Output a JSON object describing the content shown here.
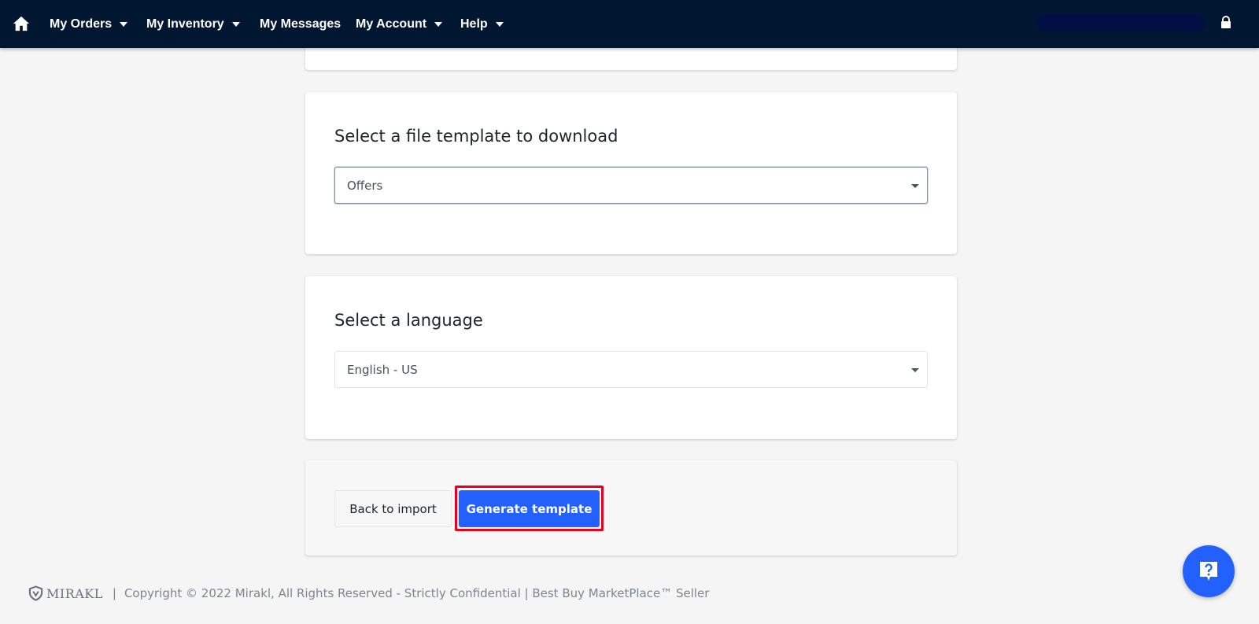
{
  "nav": {
    "home_icon": "home-icon",
    "items": [
      {
        "label": "My Orders",
        "dropdown": true
      },
      {
        "label": "My Inventory",
        "dropdown": true
      },
      {
        "label": "My Messages",
        "dropdown": false
      },
      {
        "label": "My Account",
        "dropdown": true
      },
      {
        "label": "Help",
        "dropdown": true
      }
    ],
    "lock_icon": "lock-icon"
  },
  "template_section": {
    "title": "Select a file template to download",
    "selected": "Offers"
  },
  "language_section": {
    "title": "Select a language",
    "selected": "English - US"
  },
  "actions": {
    "back_label": "Back to import",
    "generate_label": "Generate template"
  },
  "footer": {
    "logo_text": "MIRAKL",
    "separator": "|",
    "copyright": "Copyright © 2022 Mirakl, All Rights Reserved - Strictly Confidential | Best Buy MarketPlace™ Seller"
  },
  "help_button": {
    "icon": "question-icon"
  },
  "colors": {
    "topbar": "#001631",
    "primary": "#2361ff",
    "highlight": "#e6001f",
    "page_bg": "#f5f5f5"
  }
}
